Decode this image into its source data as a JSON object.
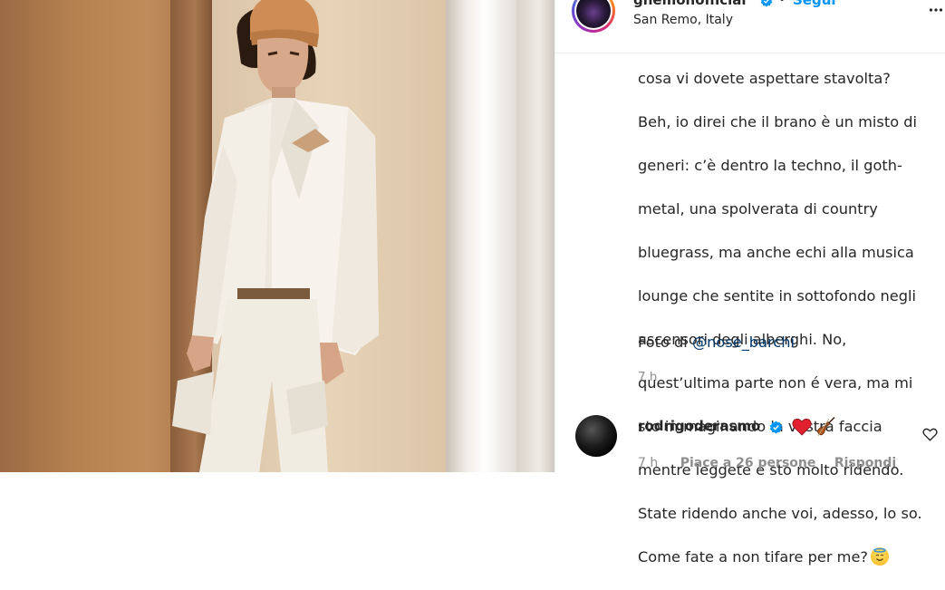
{
  "post": {
    "username": "gnemonofficial",
    "follow_label": "Segui",
    "location": "San Remo, Italy",
    "caption_lines": [
      "cosa vi dovete aspettare stavolta?",
      "Beh, io direi che il brano è un misto di",
      "generi: c’è dentro la techno, il goth-",
      "metal, una spolverata di country",
      "bluegrass, ma anche echi alla musica",
      "lounge che sentite in sottofondo negli",
      "ascensori degli alberghi. No,",
      "quest’ultima parte non é vera, ma mi",
      "sto immaginando la vostra faccia",
      "mentre leggete e sto molto ridendo.",
      "State ridendo anche voi, adesso, lo so.",
      "Come fate a non tifare per me?"
    ],
    "caption_emoji": "smiling-face-with-halo",
    "photo_credit_prefix": "Foto di",
    "photo_credit_mention": "@nose_barchi",
    "time": "7 h"
  },
  "comment": {
    "username": "rodrigoderasmo",
    "emojis": [
      "red-heart",
      "violin"
    ],
    "time": "7 h",
    "likes_label": "Piace a 26 persone",
    "reply_label": "Rispondi"
  },
  "colors": {
    "link": "#0095f6",
    "mention": "#00376b",
    "secondary_text": "#8e8e8e",
    "verified": "#0095f6"
  }
}
